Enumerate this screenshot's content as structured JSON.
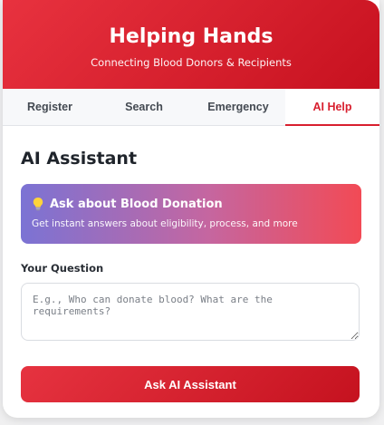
{
  "app": {
    "title": "Helping Hands",
    "subtitle": "Connecting Blood Donors & Recipients"
  },
  "tabs": [
    {
      "label": "Register",
      "active": false
    },
    {
      "label": "Search",
      "active": false
    },
    {
      "label": "Emergency",
      "active": false
    },
    {
      "label": "AI Help",
      "active": true
    }
  ],
  "main": {
    "section_title": "AI Assistant",
    "info": {
      "icon": "lightbulb-icon",
      "title": "Ask about Blood Donation",
      "description": "Get instant answers about eligibility, process, and more"
    },
    "question_label": "Your Question",
    "question_value": "",
    "question_placeholder": "E.g., Who can donate blood? What are the requirements?",
    "ask_button": "Ask AI Assistant"
  },
  "colors": {
    "brand_red": "#d81f2e",
    "gradient_start": "#7b73d4",
    "gradient_end": "#f24a55"
  }
}
